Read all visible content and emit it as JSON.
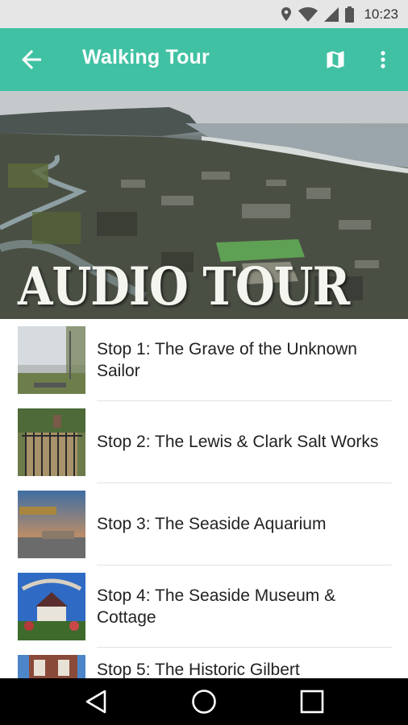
{
  "status_bar": {
    "time": "10:23",
    "icons": [
      "location-icon",
      "wifi-icon",
      "signal-icon",
      "battery-icon"
    ]
  },
  "app_bar": {
    "title": "Walking Tour",
    "background_color": "#41c1a3",
    "icons": [
      "back-arrow-icon",
      "map-icon",
      "more-vert-icon"
    ]
  },
  "hero": {
    "title": "AUDIO TOUR"
  },
  "stops": [
    {
      "label": "Stop 1: The Grave of the Unknown Sailor"
    },
    {
      "label": "Stop 2: The Lewis & Clark Salt Works"
    },
    {
      "label": "Stop 3: The Seaside Aquarium"
    },
    {
      "label": "Stop 4: The Seaside Museum & Cottage"
    },
    {
      "label": "Stop 5: The Historic Gilbert"
    }
  ],
  "nav_bar": {
    "icons": [
      "back-triangle-icon",
      "home-circle-icon",
      "recents-square-icon"
    ]
  }
}
